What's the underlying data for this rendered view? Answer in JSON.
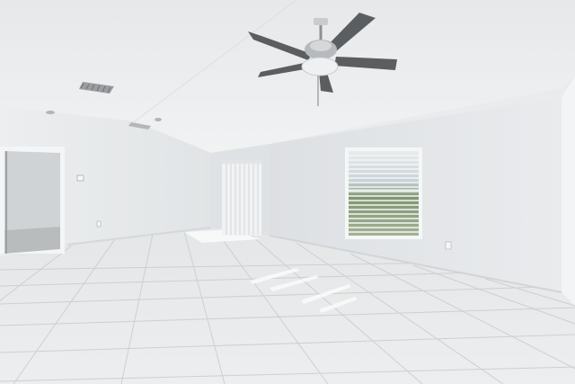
{
  "scene": {
    "type": "photo",
    "subject": "empty-room-interior",
    "colors": {
      "ceiling": "#eceef0",
      "wall_left": "#e6e8ea",
      "wall_back": "#e4e6e8",
      "wall_right": "#eef0f1",
      "floor": "#e7e9ea",
      "grout": "#c9cccd",
      "fan_blade": "#5b5e60",
      "fan_body": "#c9cbcd",
      "window_glass": "#8fa37f",
      "blind": "#f2f3f3",
      "doorway_interior": "#cfd3d6"
    },
    "icons": [
      "ceiling-fan-icon",
      "air-vent-icon",
      "recessed-light-icon",
      "outlet-icon",
      "thermostat-icon"
    ]
  }
}
